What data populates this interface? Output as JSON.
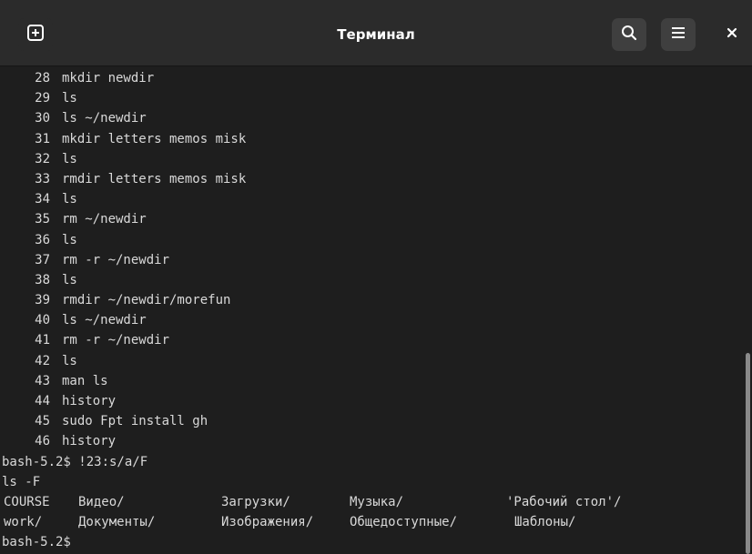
{
  "window": {
    "title": "Терминал"
  },
  "icons": {
    "new_tab": "new-tab-icon",
    "search": "search-icon",
    "menu": "hamburger-menu-icon",
    "close": "close-icon"
  },
  "colors": {
    "titlebar_bg": "#2b2b2b",
    "terminal_bg": "#1e1e1e",
    "terminal_text": "#d9d9d9",
    "button_bg": "#3f3f3f"
  },
  "history": [
    {
      "num": "28",
      "cmd": "mkdir newdir"
    },
    {
      "num": "29",
      "cmd": "ls"
    },
    {
      "num": "30",
      "cmd": "ls ~/newdir"
    },
    {
      "num": "31",
      "cmd": "mkdir letters memos misk"
    },
    {
      "num": "32",
      "cmd": "ls"
    },
    {
      "num": "33",
      "cmd": "rmdir letters memos misk"
    },
    {
      "num": "34",
      "cmd": "ls"
    },
    {
      "num": "35",
      "cmd": "rm ~/newdir"
    },
    {
      "num": "36",
      "cmd": "ls"
    },
    {
      "num": "37",
      "cmd": "rm -r ~/newdir"
    },
    {
      "num": "38",
      "cmd": "ls"
    },
    {
      "num": "39",
      "cmd": "rmdir ~/newdir/morefun"
    },
    {
      "num": "40",
      "cmd": "ls ~/newdir"
    },
    {
      "num": "41",
      "cmd": "rm -r ~/newdir"
    },
    {
      "num": "42",
      "cmd": "ls"
    },
    {
      "num": "43",
      "cmd": "man ls"
    },
    {
      "num": "44",
      "cmd": "history"
    },
    {
      "num": "45",
      "cmd": "sudo Fpt install gh"
    },
    {
      "num": "46",
      "cmd": "history"
    }
  ],
  "prompt_command": "bash-5.2$ !23:s/a/F",
  "expanded_command": "ls -F",
  "ls_rows": [
    [
      "COURSE",
      "Видео/",
      "Загрузки/",
      "Музыка/",
      "'Рабочий стол'/"
    ],
    [
      "work/",
      "Документы/",
      "Изображения/",
      "Общедоступные/",
      "Шаблоны/"
    ]
  ],
  "final_prompt": "bash-5.2$"
}
